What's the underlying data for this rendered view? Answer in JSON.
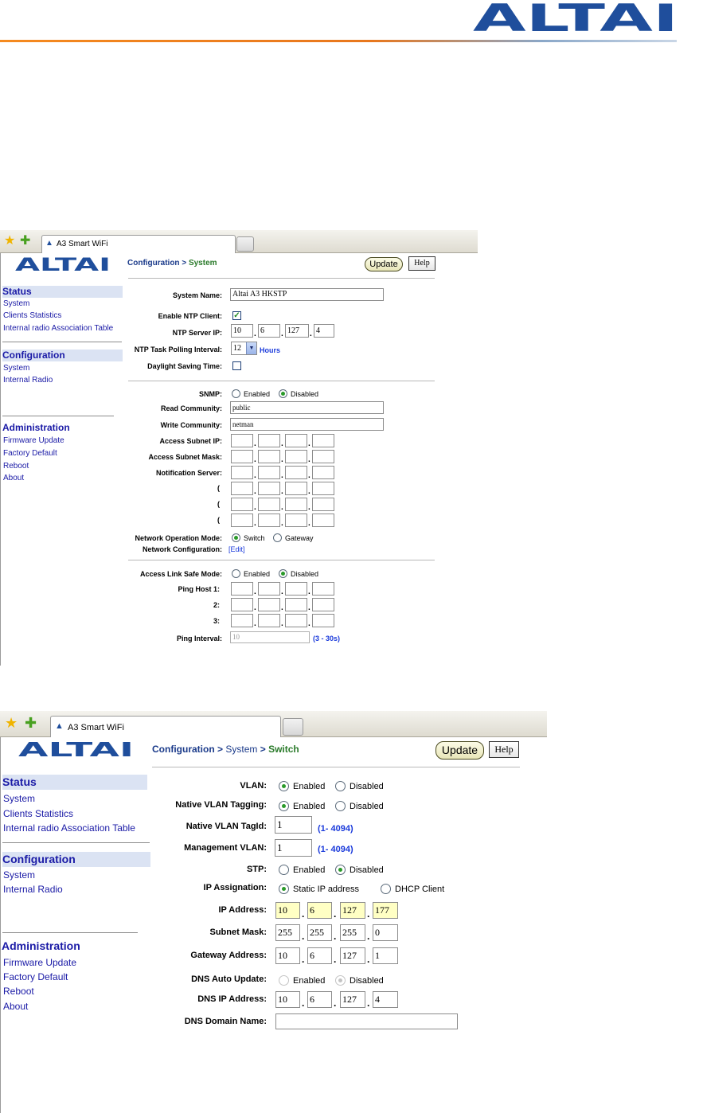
{
  "brand": "ALTAI",
  "browser": {
    "tab_label": "A3 Smart WiFi"
  },
  "nav": {
    "status": "Status",
    "status_items": [
      "System",
      "Clients Statistics",
      "Internal radio Association Table"
    ],
    "configuration": "Configuration",
    "config_items": [
      "System",
      "Internal Radio"
    ],
    "administration": "Administration",
    "admin_items": [
      "Firmware Update",
      "Factory Default",
      "Reboot",
      "About"
    ]
  },
  "buttons": {
    "update": "Update",
    "help": "Help"
  },
  "common": {
    "enabled": "Enabled",
    "disabled": "Disabled",
    "dot": "."
  },
  "system_page": {
    "breadcrumb": {
      "section": "Configuration",
      "sep": ">",
      "page": "System"
    },
    "system_name": {
      "label": "System Name:",
      "value": "Altai A3 HKSTP"
    },
    "ntp_client": {
      "label": "Enable NTP Client:",
      "checked": true
    },
    "ntp_server": {
      "label": "NTP Server IP:",
      "octets": [
        "10",
        "6",
        "127",
        "4"
      ]
    },
    "ntp_polling": {
      "label": "NTP Task Polling Interval:",
      "value": "12",
      "unit": "Hours"
    },
    "daylight": {
      "label": "Daylight Saving Time:",
      "checked": false
    },
    "snmp": {
      "label": "SNMP:",
      "selected": "Disabled"
    },
    "read_community": {
      "label": "Read Community:",
      "value": "public"
    },
    "write_community": {
      "label": "Write Community:",
      "value": "netman"
    },
    "access_subnet_ip": {
      "label": "Access Subnet IP:"
    },
    "access_subnet_mask": {
      "label": "Access Subnet Mask:"
    },
    "notification_server": {
      "label": "Notification Server:",
      "extra_marks": [
        "(",
        "(",
        "("
      ]
    },
    "network_mode": {
      "label": "Network Operation Mode:",
      "options": [
        "Switch",
        "Gateway"
      ],
      "selected": "Switch"
    },
    "network_config": {
      "label": "Network Configuration:",
      "link": "[Edit]"
    },
    "access_link_safe": {
      "label": "Access Link Safe Mode:",
      "selected": "Disabled"
    },
    "ping_host": {
      "labels": [
        "Ping Host 1:",
        "2:",
        "3:"
      ]
    },
    "ping_interval": {
      "label": "Ping Interval:",
      "value": "10",
      "range": "(3 - 30s)"
    }
  },
  "switch_page": {
    "breadcrumb": {
      "section": "Configuration",
      "sep": ">",
      "page": "System",
      "sub": "Switch"
    },
    "vlan": {
      "label": "VLAN:",
      "selected": "Enabled"
    },
    "native_vlan_tagging": {
      "label": "Native VLAN Tagging:",
      "selected": "Enabled"
    },
    "native_vlan_tagid": {
      "label": "Native VLAN TagId:",
      "value": "1",
      "range": "(1- 4094)"
    },
    "management_vlan": {
      "label": "Management VLAN:",
      "value": "1",
      "range": "(1- 4094)"
    },
    "stp": {
      "label": "STP:",
      "selected": "Disabled"
    },
    "ip_assignation": {
      "label": "IP Assignation:",
      "options": [
        "Static IP address",
        "DHCP Client"
      ],
      "selected": "Static IP address"
    },
    "ip_address": {
      "label": "IP Address:",
      "octets": [
        "10",
        "6",
        "127",
        "177"
      ]
    },
    "subnet_mask": {
      "label": "Subnet Mask:",
      "octets": [
        "255",
        "255",
        "255",
        "0"
      ]
    },
    "gateway": {
      "label": "Gateway Address:",
      "octets": [
        "10",
        "6",
        "127",
        "1"
      ]
    },
    "dns_auto": {
      "label": "DNS Auto Update:",
      "selected": "Disabled"
    },
    "dns_ip": {
      "label": "DNS IP Address:",
      "octets": [
        "10",
        "6",
        "127",
        "4"
      ]
    },
    "dns_domain": {
      "label": "DNS Domain Name:",
      "value": ""
    }
  }
}
